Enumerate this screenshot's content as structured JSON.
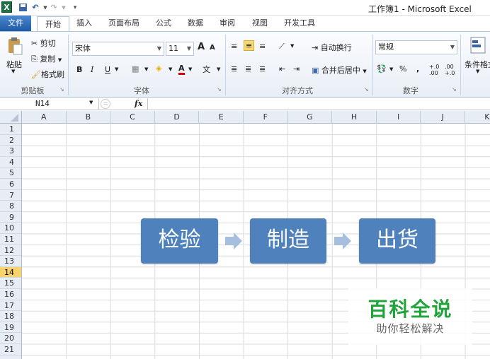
{
  "window": {
    "title": "工作簿1 - Microsoft Excel"
  },
  "tabs": [
    "文件",
    "开始",
    "插入",
    "页面布局",
    "公式",
    "数据",
    "审阅",
    "视图",
    "开发工具"
  ],
  "clipboard": {
    "paste": "粘贴",
    "cut": "剪切",
    "copy": "复制",
    "format_painter": "格式刷",
    "group": "剪贴板"
  },
  "font": {
    "name": "宋体",
    "size": "11",
    "group": "字体",
    "bold": "B",
    "italic": "I",
    "underline": "U",
    "grow": "A",
    "shrink": "A",
    "color_letter": "A",
    "phonetic": "文"
  },
  "alignment": {
    "wrap": "自动换行",
    "merge": "合并后居中",
    "group": "对齐方式"
  },
  "number": {
    "format": "常规",
    "percent": "%",
    "comma": ",",
    "inc_dec": "+.0 .00",
    "dec_dec": ".00 +.0",
    "group": "数字"
  },
  "styles": {
    "conditional": "条件格式"
  },
  "formula_bar": {
    "cell_ref": "N14",
    "fx": "fx",
    "value": ""
  },
  "columns": [
    "A",
    "B",
    "C",
    "D",
    "E",
    "F",
    "G",
    "H",
    "I",
    "J",
    "K"
  ],
  "rows": [
    "1",
    "2",
    "3",
    "4",
    "5",
    "6",
    "7",
    "8",
    "9",
    "10",
    "11",
    "12",
    "13",
    "14",
    "15",
    "16",
    "17",
    "18",
    "19",
    "20",
    "21"
  ],
  "selected_row": "14",
  "process": [
    "检验",
    "制造",
    "出货"
  ],
  "watermark": {
    "title": "百科全说",
    "subtitle": "助你轻松解决"
  },
  "colors": {
    "box": "#4f81bd",
    "arrow": "#a7bfde",
    "file_tab": "#2a6db8",
    "selected_row": "#f8d36a",
    "watermark": "#21a53a"
  }
}
